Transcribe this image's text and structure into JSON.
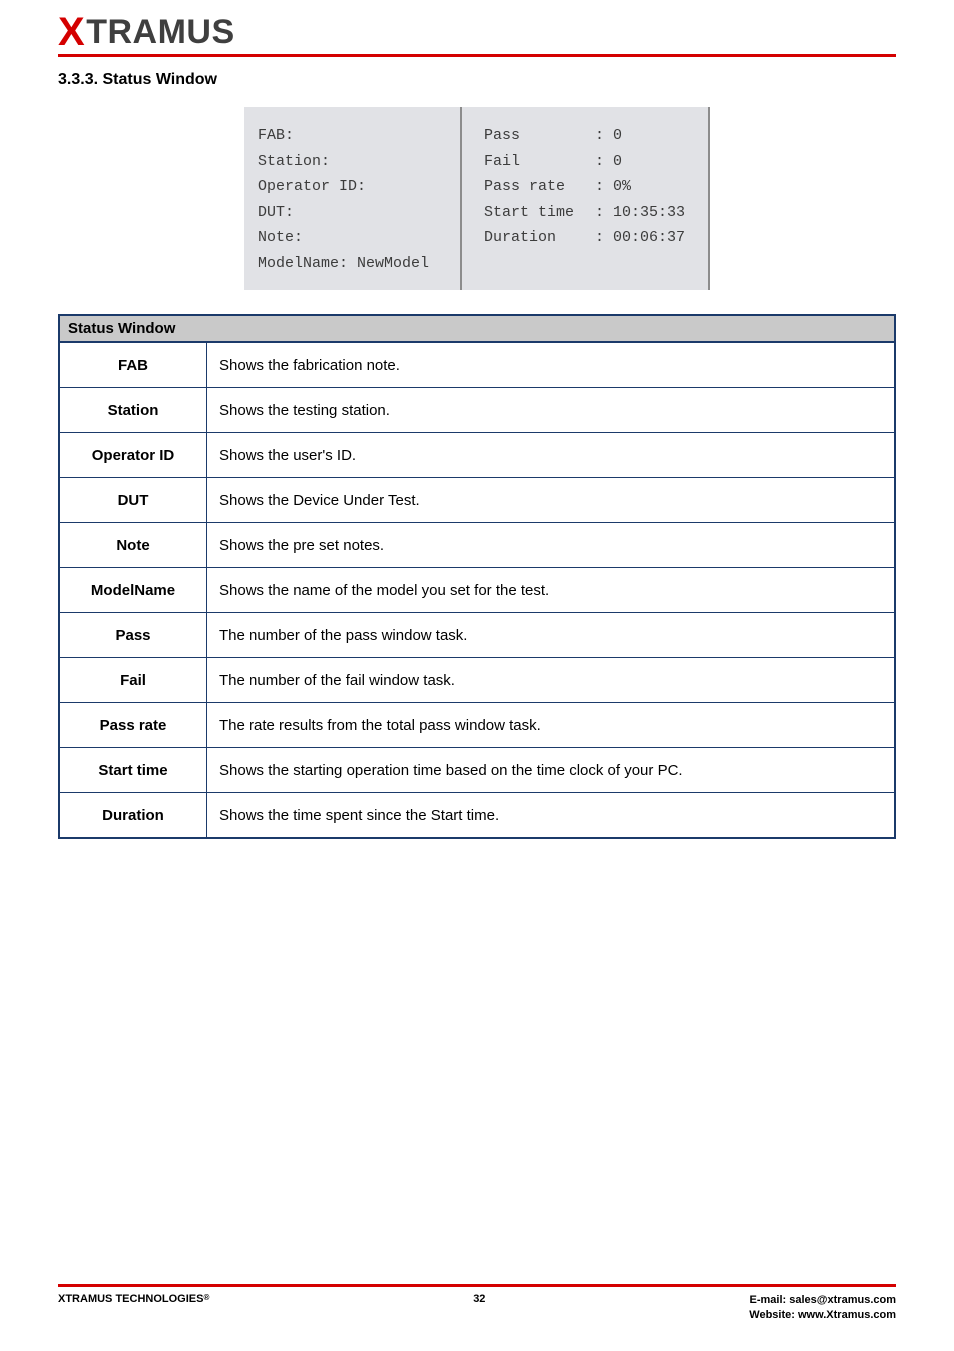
{
  "brand": {
    "x": "X",
    "rest": "TRAMUS"
  },
  "section_title": "3.3.3. Status Window",
  "statusbox_left": {
    "l1": "FAB:",
    "l2": "Station:",
    "l3": "Operator ID:",
    "l4": "DUT:",
    "l5": "Note:",
    "l6": "ModelName: NewModel"
  },
  "statusbox_right": {
    "r1_lab": "Pass",
    "r1_val": ": 0",
    "r2_lab": "Fail",
    "r2_val": ": 0",
    "r3_lab": "Pass rate",
    "r3_val": ":   0%",
    "r4_lab": "Start time",
    "r4_val": ": 10:35:33",
    "r5_lab": "Duration",
    "r5_val": ": 00:06:37"
  },
  "table": {
    "header": "Status Window",
    "rows": [
      {
        "key": "FAB",
        "desc": "Shows the fabrication note."
      },
      {
        "key": "Station",
        "desc": "Shows the testing station."
      },
      {
        "key": "Operator ID",
        "desc": "Shows the user's ID."
      },
      {
        "key": "DUT",
        "desc": "Shows the Device Under Test."
      },
      {
        "key": "Note",
        "desc": "Shows the pre set notes."
      },
      {
        "key": "ModelName",
        "desc": "Shows the name of the model you set for the test."
      },
      {
        "key": "Pass",
        "desc": "The number of the pass window task."
      },
      {
        "key": "Fail",
        "desc": "The number of the fail window task."
      },
      {
        "key": "Pass rate",
        "desc": "The rate results from the total pass window task."
      },
      {
        "key": "Start time",
        "desc": "Shows the starting operation time based on the time clock of your PC."
      },
      {
        "key": "Duration",
        "desc": "Shows the time spent since the Start time."
      }
    ]
  },
  "footer": {
    "company": "XTRAMUS TECHNOLOGIES",
    "reg": "®",
    "page": "32",
    "email_label": "E-mail: ",
    "email": "sales@xtramus.com",
    "site_label": "Website:  ",
    "site": "www.Xtramus.com"
  }
}
